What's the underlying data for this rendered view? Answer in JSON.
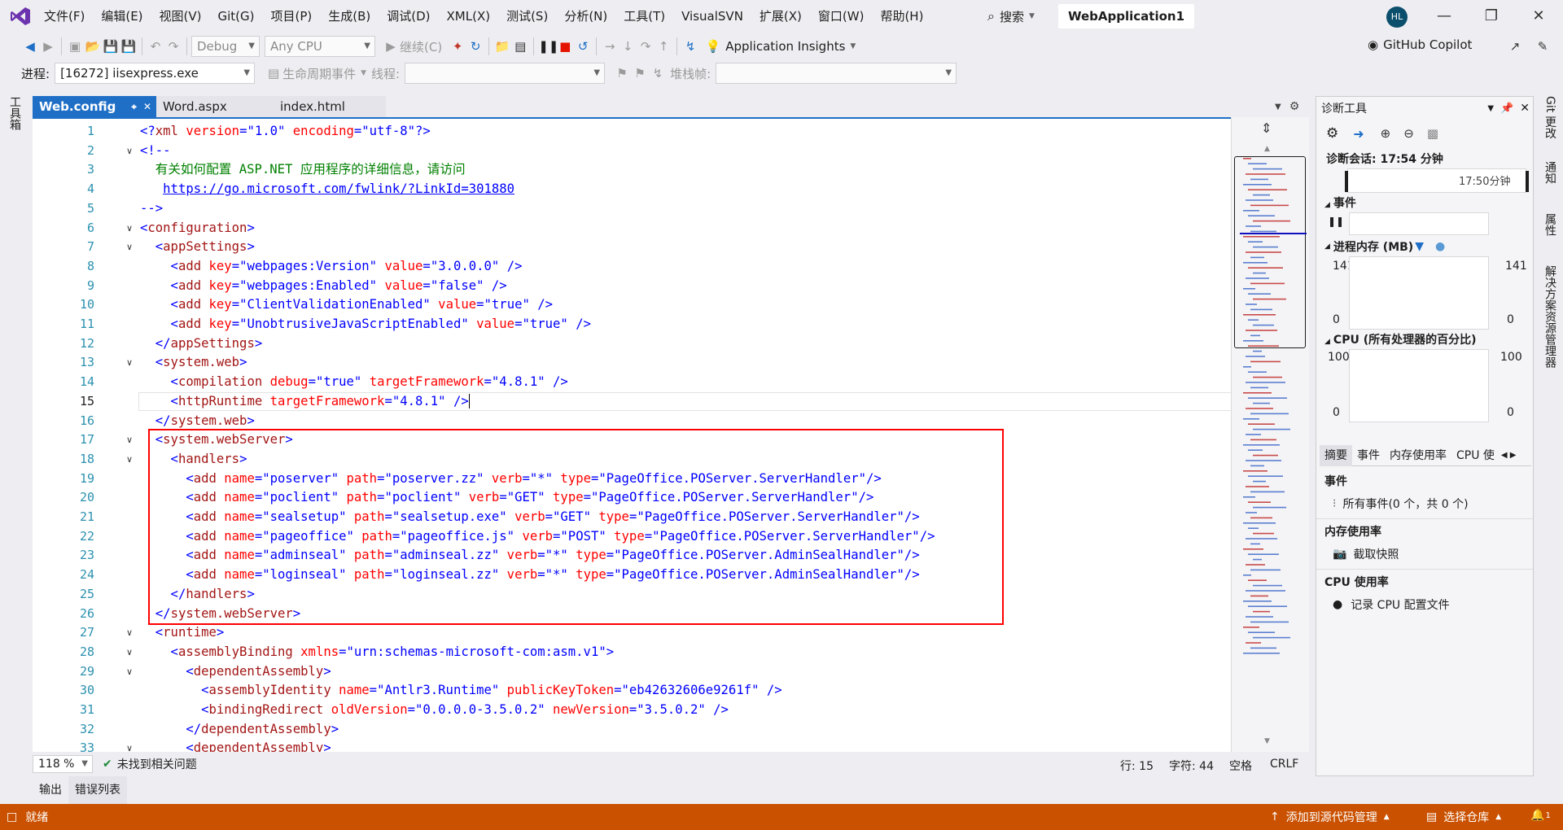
{
  "menu": {
    "items": [
      "文件(F)",
      "编辑(E)",
      "视图(V)",
      "Git(G)",
      "项目(P)",
      "生成(B)",
      "调试(D)",
      "XML(X)",
      "测试(S)",
      "分析(N)",
      "工具(T)",
      "VisualSVN",
      "扩展(X)",
      "窗口(W)",
      "帮助(H)"
    ],
    "search_label": "搜索",
    "solution_name": "WebApplication1",
    "avatar_initials": "HL"
  },
  "toolbar1": {
    "config": "Debug",
    "platform": "Any CPU",
    "continue_label": "继续(C)",
    "insights_label": "Application Insights",
    "copilot_label": "GitHub Copilot"
  },
  "toolbar2": {
    "process_label": "进程:",
    "process_value": "[16272] iisexpress.exe",
    "lifecycle_label": "生命周期事件",
    "thread_label": "线程:",
    "stackframe_label": "堆栈帧:"
  },
  "left_strip": {
    "toolbox_label": "工具箱"
  },
  "tabs": [
    {
      "label": "Web.config",
      "active": true
    },
    {
      "label": "Word.aspx",
      "active": false
    },
    {
      "label": "index.html",
      "active": false
    }
  ],
  "editor": {
    "current_line": 15,
    "highlight_from_line": 17,
    "highlight_to_line": 26,
    "lines": [
      {
        "n": 1,
        "fold": "",
        "segs": [
          [
            "br",
            "<?"
          ],
          [
            "tg",
            "xml"
          ],
          [
            "at",
            " version"
          ],
          [
            "br",
            "="
          ],
          [
            "vl",
            "\"1.0\""
          ],
          [
            "at",
            " encoding"
          ],
          [
            "br",
            "="
          ],
          [
            "vl",
            "\"utf-8\""
          ],
          [
            "br",
            "?>"
          ]
        ]
      },
      {
        "n": 2,
        "fold": "v",
        "segs": [
          [
            "br",
            "<!--"
          ]
        ]
      },
      {
        "n": 3,
        "fold": "",
        "segs": [
          [
            "cm",
            "  有关如何配置 ASP.NET 应用程序的详细信息，请访问"
          ]
        ]
      },
      {
        "n": 4,
        "fold": "",
        "segs": [
          [
            "cm",
            "   "
          ],
          [
            "ul",
            "https://go.microsoft.com/fwlink/?LinkId=301880"
          ]
        ]
      },
      {
        "n": 5,
        "fold": "",
        "segs": [
          [
            "br",
            "-->"
          ]
        ]
      },
      {
        "n": 6,
        "fold": "v",
        "segs": [
          [
            "br",
            "<"
          ],
          [
            "tg",
            "configuration"
          ],
          [
            "br",
            ">"
          ]
        ]
      },
      {
        "n": 7,
        "fold": "v",
        "segs": [
          [
            "br",
            "  <"
          ],
          [
            "tg",
            "appSettings"
          ],
          [
            "br",
            ">"
          ]
        ]
      },
      {
        "n": 8,
        "fold": "",
        "segs": [
          [
            "br",
            "    <"
          ],
          [
            "tg",
            "add"
          ],
          [
            "at",
            " key"
          ],
          [
            "br",
            "="
          ],
          [
            "vl",
            "\"webpages:Version\""
          ],
          [
            "at",
            " value"
          ],
          [
            "br",
            "="
          ],
          [
            "vl",
            "\"3.0.0.0\""
          ],
          [
            "br",
            " />"
          ]
        ]
      },
      {
        "n": 9,
        "fold": "",
        "segs": [
          [
            "br",
            "    <"
          ],
          [
            "tg",
            "add"
          ],
          [
            "at",
            " key"
          ],
          [
            "br",
            "="
          ],
          [
            "vl",
            "\"webpages:Enabled\""
          ],
          [
            "at",
            " value"
          ],
          [
            "br",
            "="
          ],
          [
            "vl",
            "\"false\""
          ],
          [
            "br",
            " />"
          ]
        ]
      },
      {
        "n": 10,
        "fold": "",
        "segs": [
          [
            "br",
            "    <"
          ],
          [
            "tg",
            "add"
          ],
          [
            "at",
            " key"
          ],
          [
            "br",
            "="
          ],
          [
            "vl",
            "\"ClientValidationEnabled\""
          ],
          [
            "at",
            " value"
          ],
          [
            "br",
            "="
          ],
          [
            "vl",
            "\"true\""
          ],
          [
            "br",
            " />"
          ]
        ]
      },
      {
        "n": 11,
        "fold": "",
        "segs": [
          [
            "br",
            "    <"
          ],
          [
            "tg",
            "add"
          ],
          [
            "at",
            " key"
          ],
          [
            "br",
            "="
          ],
          [
            "vl",
            "\"UnobtrusiveJavaScriptEnabled\""
          ],
          [
            "at",
            " value"
          ],
          [
            "br",
            "="
          ],
          [
            "vl",
            "\"true\""
          ],
          [
            "br",
            " />"
          ]
        ]
      },
      {
        "n": 12,
        "fold": "",
        "segs": [
          [
            "br",
            "  </"
          ],
          [
            "tg",
            "appSettings"
          ],
          [
            "br",
            ">"
          ]
        ]
      },
      {
        "n": 13,
        "fold": "v",
        "segs": [
          [
            "br",
            "  <"
          ],
          [
            "tg",
            "system.web"
          ],
          [
            "br",
            ">"
          ]
        ]
      },
      {
        "n": 14,
        "fold": "",
        "segs": [
          [
            "br",
            "    <"
          ],
          [
            "tg",
            "compilation"
          ],
          [
            "at",
            " debug"
          ],
          [
            "br",
            "="
          ],
          [
            "vl",
            "\"true\""
          ],
          [
            "at",
            " targetFramework"
          ],
          [
            "br",
            "="
          ],
          [
            "vl",
            "\"4.8.1\""
          ],
          [
            "br",
            " />"
          ]
        ]
      },
      {
        "n": 15,
        "fold": "",
        "segs": [
          [
            "br",
            "    <"
          ],
          [
            "tg",
            "httpRuntime"
          ],
          [
            "at",
            " targetFramework"
          ],
          [
            "br",
            "="
          ],
          [
            "vl",
            "\"4.8.1\""
          ],
          [
            "br",
            " />"
          ]
        ]
      },
      {
        "n": 16,
        "fold": "",
        "segs": [
          [
            "br",
            "  </"
          ],
          [
            "tg",
            "system.web"
          ],
          [
            "br",
            ">"
          ]
        ]
      },
      {
        "n": 17,
        "fold": "v",
        "segs": [
          [
            "br",
            "  <"
          ],
          [
            "tg",
            "system.webServer"
          ],
          [
            "br",
            ">"
          ]
        ]
      },
      {
        "n": 18,
        "fold": "v",
        "segs": [
          [
            "br",
            "    <"
          ],
          [
            "tg",
            "handlers"
          ],
          [
            "br",
            ">"
          ]
        ]
      },
      {
        "n": 19,
        "fold": "",
        "segs": [
          [
            "br",
            "      <"
          ],
          [
            "tg",
            "add"
          ],
          [
            "at",
            " name"
          ],
          [
            "br",
            "="
          ],
          [
            "vl",
            "\"poserver\""
          ],
          [
            "at",
            " path"
          ],
          [
            "br",
            "="
          ],
          [
            "vl",
            "\"poserver.zz\""
          ],
          [
            "at",
            " verb"
          ],
          [
            "br",
            "="
          ],
          [
            "vl",
            "\"*\""
          ],
          [
            "at",
            " type"
          ],
          [
            "br",
            "="
          ],
          [
            "vl",
            "\"PageOffice.POServer.ServerHandler\""
          ],
          [
            "br",
            "/>"
          ]
        ]
      },
      {
        "n": 20,
        "fold": "",
        "segs": [
          [
            "br",
            "      <"
          ],
          [
            "tg",
            "add"
          ],
          [
            "at",
            " name"
          ],
          [
            "br",
            "="
          ],
          [
            "vl",
            "\"poclient\""
          ],
          [
            "at",
            " path"
          ],
          [
            "br",
            "="
          ],
          [
            "vl",
            "\"poclient\""
          ],
          [
            "at",
            " verb"
          ],
          [
            "br",
            "="
          ],
          [
            "vl",
            "\"GET\""
          ],
          [
            "at",
            " type"
          ],
          [
            "br",
            "="
          ],
          [
            "vl",
            "\"PageOffice.POServer.ServerHandler\""
          ],
          [
            "br",
            "/>"
          ]
        ]
      },
      {
        "n": 21,
        "fold": "",
        "segs": [
          [
            "br",
            "      <"
          ],
          [
            "tg",
            "add"
          ],
          [
            "at",
            " name"
          ],
          [
            "br",
            "="
          ],
          [
            "vl",
            "\"sealsetup\""
          ],
          [
            "at",
            " path"
          ],
          [
            "br",
            "="
          ],
          [
            "vl",
            "\"sealsetup.exe\""
          ],
          [
            "at",
            " verb"
          ],
          [
            "br",
            "="
          ],
          [
            "vl",
            "\"GET\""
          ],
          [
            "at",
            " type"
          ],
          [
            "br",
            "="
          ],
          [
            "vl",
            "\"PageOffice.POServer.ServerHandler\""
          ],
          [
            "br",
            "/>"
          ]
        ]
      },
      {
        "n": 22,
        "fold": "",
        "segs": [
          [
            "br",
            "      <"
          ],
          [
            "tg",
            "add"
          ],
          [
            "at",
            " name"
          ],
          [
            "br",
            "="
          ],
          [
            "vl",
            "\"pageoffice\""
          ],
          [
            "at",
            " path"
          ],
          [
            "br",
            "="
          ],
          [
            "vl",
            "\"pageoffice.js\""
          ],
          [
            "at",
            " verb"
          ],
          [
            "br",
            "="
          ],
          [
            "vl",
            "\"POST\""
          ],
          [
            "at",
            " type"
          ],
          [
            "br",
            "="
          ],
          [
            "vl",
            "\"PageOffice.POServer.ServerHandler\""
          ],
          [
            "br",
            "/>"
          ]
        ]
      },
      {
        "n": 23,
        "fold": "",
        "segs": [
          [
            "br",
            "      <"
          ],
          [
            "tg",
            "add"
          ],
          [
            "at",
            " name"
          ],
          [
            "br",
            "="
          ],
          [
            "vl",
            "\"adminseal\""
          ],
          [
            "at",
            " path"
          ],
          [
            "br",
            "="
          ],
          [
            "vl",
            "\"adminseal.zz\""
          ],
          [
            "at",
            " verb"
          ],
          [
            "br",
            "="
          ],
          [
            "vl",
            "\"*\""
          ],
          [
            "at",
            " type"
          ],
          [
            "br",
            "="
          ],
          [
            "vl",
            "\"PageOffice.POServer.AdminSealHandler\""
          ],
          [
            "br",
            "/>"
          ]
        ]
      },
      {
        "n": 24,
        "fold": "",
        "segs": [
          [
            "br",
            "      <"
          ],
          [
            "tg",
            "add"
          ],
          [
            "at",
            " name"
          ],
          [
            "br",
            "="
          ],
          [
            "vl",
            "\"loginseal\""
          ],
          [
            "at",
            " path"
          ],
          [
            "br",
            "="
          ],
          [
            "vl",
            "\"loginseal.zz\""
          ],
          [
            "at",
            " verb"
          ],
          [
            "br",
            "="
          ],
          [
            "vl",
            "\"*\""
          ],
          [
            "at",
            " type"
          ],
          [
            "br",
            "="
          ],
          [
            "vl",
            "\"PageOffice.POServer.AdminSealHandler\""
          ],
          [
            "br",
            "/>"
          ]
        ]
      },
      {
        "n": 25,
        "fold": "",
        "segs": [
          [
            "br",
            "    </"
          ],
          [
            "tg",
            "handlers"
          ],
          [
            "br",
            ">"
          ]
        ]
      },
      {
        "n": 26,
        "fold": "",
        "segs": [
          [
            "br",
            "  </"
          ],
          [
            "tg",
            "system.webServer"
          ],
          [
            "br",
            ">"
          ]
        ]
      },
      {
        "n": 27,
        "fold": "v",
        "segs": [
          [
            "br",
            "  <"
          ],
          [
            "tg",
            "runtime"
          ],
          [
            "br",
            ">"
          ]
        ]
      },
      {
        "n": 28,
        "fold": "v",
        "segs": [
          [
            "br",
            "    <"
          ],
          [
            "tg",
            "assemblyBinding"
          ],
          [
            "at",
            " xmlns"
          ],
          [
            "br",
            "="
          ],
          [
            "vl",
            "\"urn:schemas-microsoft-com:asm.v1\""
          ],
          [
            "br",
            ">"
          ]
        ]
      },
      {
        "n": 29,
        "fold": "v",
        "segs": [
          [
            "br",
            "      <"
          ],
          [
            "tg",
            "dependentAssembly"
          ],
          [
            "br",
            ">"
          ]
        ]
      },
      {
        "n": 30,
        "fold": "",
        "segs": [
          [
            "br",
            "        <"
          ],
          [
            "tg",
            "assemblyIdentity"
          ],
          [
            "at",
            " name"
          ],
          [
            "br",
            "="
          ],
          [
            "vl",
            "\"Antlr3.Runtime\""
          ],
          [
            "at",
            " publicKeyToken"
          ],
          [
            "br",
            "="
          ],
          [
            "vl",
            "\"eb42632606e9261f\""
          ],
          [
            "br",
            " />"
          ]
        ]
      },
      {
        "n": 31,
        "fold": "",
        "segs": [
          [
            "br",
            "        <"
          ],
          [
            "tg",
            "bindingRedirect"
          ],
          [
            "at",
            " oldVersion"
          ],
          [
            "br",
            "="
          ],
          [
            "vl",
            "\"0.0.0.0-3.5.0.2\""
          ],
          [
            "at",
            " newVersion"
          ],
          [
            "br",
            "="
          ],
          [
            "vl",
            "\"3.5.0.2\""
          ],
          [
            "br",
            " />"
          ]
        ]
      },
      {
        "n": 32,
        "fold": "",
        "segs": [
          [
            "br",
            "      </"
          ],
          [
            "tg",
            "dependentAssembly"
          ],
          [
            "br",
            ">"
          ]
        ]
      },
      {
        "n": 33,
        "fold": "v",
        "segs": [
          [
            "br",
            "      <"
          ],
          [
            "tg",
            "dependentAssembly"
          ],
          [
            "br",
            ">"
          ]
        ]
      }
    ]
  },
  "editor_status": {
    "zoom": "118 %",
    "issues": "未找到相关问题",
    "line": "行: 15",
    "char": "字符: 44",
    "spaces": "空格",
    "eol": "CRLF"
  },
  "bottom_tabs": [
    "输出",
    "错误列表"
  ],
  "diagnostics": {
    "title": "诊断工具",
    "session": "诊断会话: 17:54 分钟",
    "timeline_label": "17:50分钟",
    "events_title": "事件",
    "memory_title": "进程内存 (MB)",
    "memory_max": "141",
    "memory_min": "0",
    "cpu_title": "CPU (所有处理器的百分比)",
    "cpu_max": "100",
    "cpu_min": "0",
    "tabs": [
      "摘要",
      "事件",
      "内存使用率",
      "CPU 使"
    ],
    "summary_events_title": "事件",
    "all_events": "所有事件(0 个，共 0 个)",
    "memory_usage_title": "内存使用率",
    "snapshot": "截取快照",
    "cpu_usage_title": "CPU 使用率",
    "record_cpu": "记录 CPU 配置文件"
  },
  "right_strip": [
    "Git 更改",
    "通知",
    "属性",
    "解决方案资源管理器"
  ],
  "statusbar": {
    "ready": "就绪",
    "add_source_control": "添加到源代码管理",
    "select_repo": "选择仓库",
    "notif_count": "1"
  },
  "colors": {
    "accent": "#1f6fc7",
    "status": "#ca5100",
    "highlight": "#ff0000"
  }
}
